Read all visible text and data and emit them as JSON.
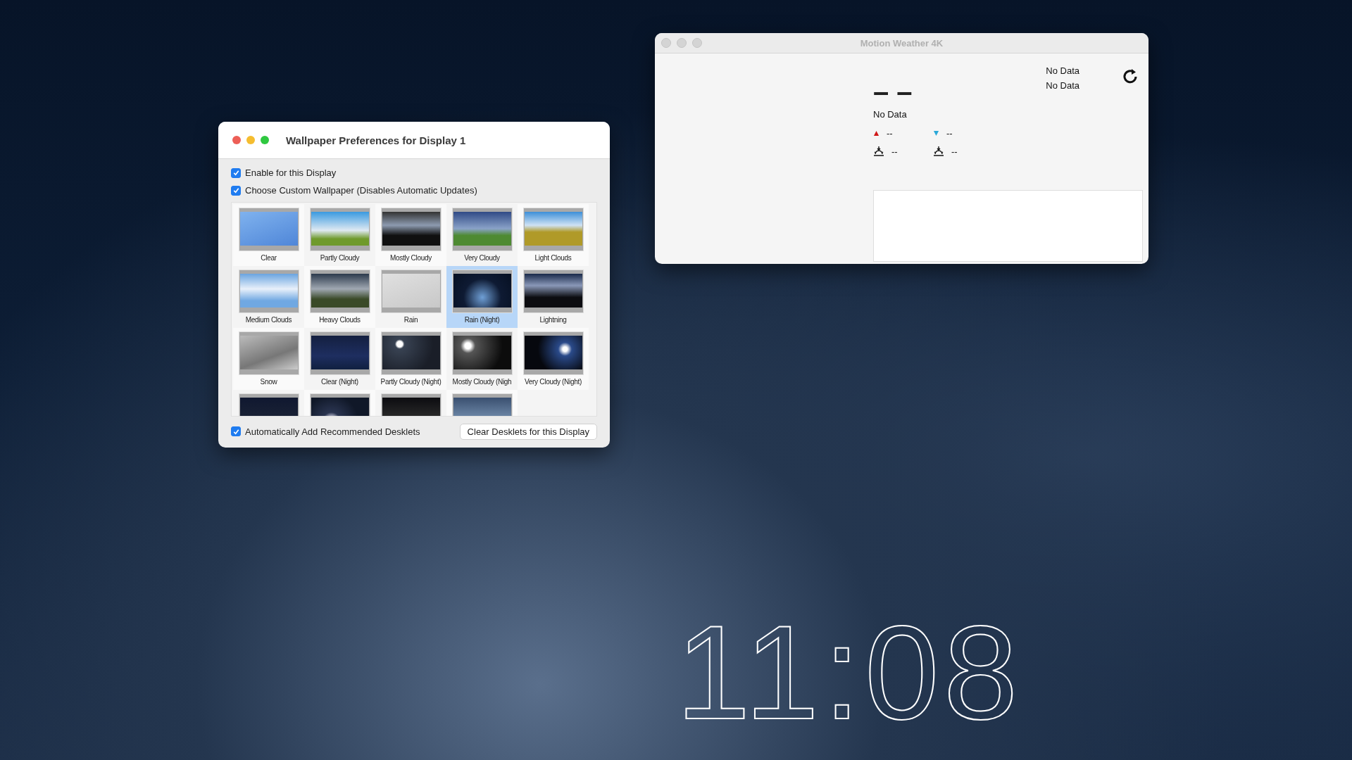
{
  "clock": {
    "time": "11:08"
  },
  "preferences_window": {
    "title": "Wallpaper Preferences for Display 1",
    "options": [
      {
        "label": "Enable for this Display",
        "checked": true
      },
      {
        "label": "Choose Custom Wallpaper (Disables Automatic Updates)",
        "checked": true
      }
    ],
    "wallpapers": [
      {
        "label": "Clear",
        "selected": false
      },
      {
        "label": "Partly Cloudy",
        "selected": false
      },
      {
        "label": "Mostly Cloudy",
        "selected": false
      },
      {
        "label": "Very Cloudy",
        "selected": false
      },
      {
        "label": "Light Clouds",
        "selected": false
      },
      {
        "label": "Medium Clouds",
        "selected": false
      },
      {
        "label": "Heavy Clouds",
        "selected": false
      },
      {
        "label": "Rain",
        "selected": false
      },
      {
        "label": "Rain (Night)",
        "selected": true
      },
      {
        "label": "Lightning",
        "selected": false
      },
      {
        "label": "Snow",
        "selected": false
      },
      {
        "label": "Clear (Night)",
        "selected": false
      },
      {
        "label": "Partly Cloudy (Night)",
        "selected": false
      },
      {
        "label": "Mostly Cloudy (Nigh",
        "selected": false
      },
      {
        "label": "Very Cloudy (Night)",
        "selected": false
      },
      {
        "selected": false
      },
      {
        "selected": false
      },
      {
        "selected": false
      },
      {
        "selected": false
      }
    ],
    "footer_option": {
      "label": "Automatically Add Recommended Desklets",
      "checked": true
    },
    "clear_button": "Clear Desklets for this Display"
  },
  "weather_window": {
    "title": "Motion Weather 4K",
    "top_right": [
      "No Data",
      "No Data"
    ],
    "temperature": "– –",
    "condition": "No Data",
    "high": "--",
    "low": "--",
    "sunrise": "--",
    "sunset": "--"
  }
}
